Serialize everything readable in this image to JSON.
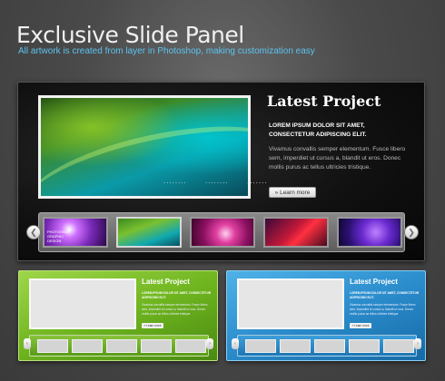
{
  "header": {
    "title": "Exclusive Slide Panel",
    "subtitle": "All artwork is created from layer in Photoshop, making customization easy"
  },
  "main_panel": {
    "title": "Latest Project",
    "lead": "LOREM IPSUM DOLOR SIT AMET, CONSECTETUR ADIPISCING ELIT.",
    "body": "Vivamus convallis semper elementum. Fusce libero sem, imperdiet ut cursus a, blandit ut eros. Donec mollis purus ac tellus ultricies tristique.",
    "button_label": "» Learn more",
    "prev_arrow": "❮",
    "next_arrow": "❯",
    "dots": [
      "........",
      "........",
      "......."
    ],
    "thumbnails": [
      {
        "name": "thumb-1",
        "text": "PHOTOSHOP GRAPHIC DESIGN",
        "active": false
      },
      {
        "name": "thumb-2",
        "active": true
      },
      {
        "name": "thumb-3",
        "active": false
      },
      {
        "name": "thumb-4",
        "active": false
      },
      {
        "name": "thumb-5",
        "active": false
      }
    ]
  },
  "mini_panels": [
    {
      "theme": "green",
      "accent": "#7cc02c",
      "title": "Latest Project",
      "lead": "LOREM IPSUM DOLOR SIT AMET, CONSECTETUR ADIPISCING ELIT.",
      "body": "Vivamus convallis semper elementum. Fusce libero sem, imperdiet ut cursus a, blandit ut eros. Donec mollis purus ac tellus ultricies tristique.",
      "button_label": "» Learn more",
      "prev_arrow": "‹",
      "next_arrow": "›",
      "thumb_count": 5
    },
    {
      "theme": "blue",
      "accent": "#2b8ccc",
      "title": "Latest Project",
      "lead": "LOREM IPSUM DOLOR SIT AMET, CONSECTETUR ADIPISCING ELIT.",
      "body": "Vivamus convallis semper elementum. Fusce libero sem, imperdiet ut cursus a, blandit ut eros. Donec mollis purus ac tellus ultricies tristique.",
      "button_label": "» Learn more",
      "prev_arrow": "‹",
      "next_arrow": "›",
      "thumb_count": 5
    }
  ]
}
